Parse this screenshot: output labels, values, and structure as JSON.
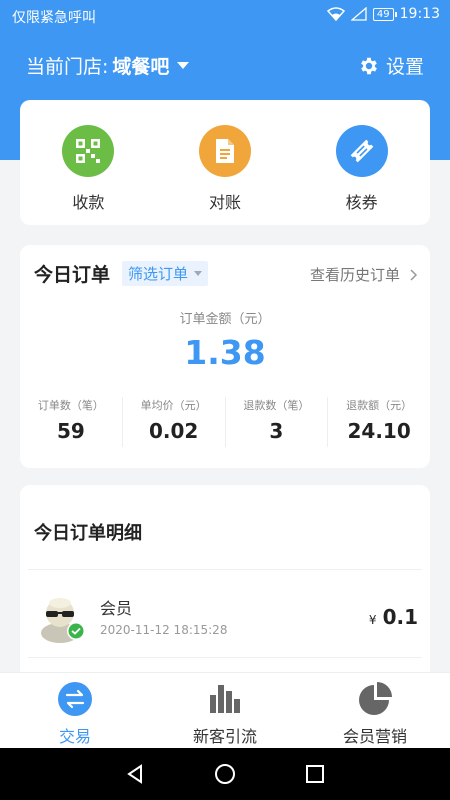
{
  "status_bar": {
    "carrier": "仅限紧急呼叫",
    "battery": "49",
    "time": "19:13"
  },
  "header": {
    "store_prefix": "当前门店:",
    "store_name": "域餐吧",
    "settings_label": "设置"
  },
  "quick_actions": [
    {
      "label": "收款",
      "icon": "qr-code-icon",
      "color": "#6cbd45"
    },
    {
      "label": "对账",
      "icon": "document-icon",
      "color": "#f0a63a"
    },
    {
      "label": "核券",
      "icon": "ticket-icon",
      "color": "#3d97f3"
    }
  ],
  "today": {
    "title": "今日订单",
    "filter_label": "筛选订单",
    "history_label": "查看历史订单",
    "amount_label": "订单金额（元）",
    "amount": "1.38",
    "stats": [
      {
        "label": "订单数（笔）",
        "value": "59"
      },
      {
        "label": "单均价（元）",
        "value": "0.02"
      },
      {
        "label": "退款数（笔）",
        "value": "3"
      },
      {
        "label": "退款额（元）",
        "value": "24.10"
      }
    ]
  },
  "detail": {
    "title": "今日订单明细",
    "rows": [
      {
        "name": "会员",
        "time": "2020-11-12 18:15:28",
        "currency": "¥",
        "amount": "0.1"
      }
    ]
  },
  "tabs": [
    {
      "label": "交易",
      "icon": "exchange-icon",
      "active": true
    },
    {
      "label": "新客引流",
      "icon": "bar-chart-icon",
      "active": false
    },
    {
      "label": "会员营销",
      "icon": "pie-chart-icon",
      "active": false
    }
  ],
  "colors": {
    "brand": "#3d97f3"
  }
}
